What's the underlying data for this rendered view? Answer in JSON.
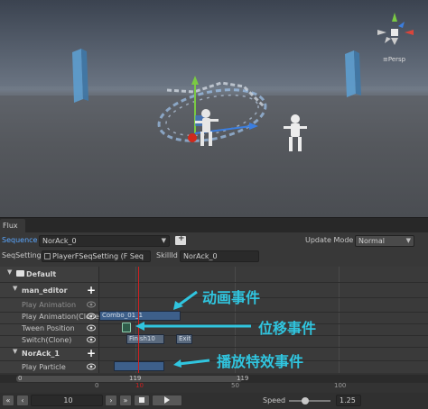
{
  "scene": {
    "gizmo_label": "≡Persp"
  },
  "panel": {
    "tab_label": "Flux"
  },
  "sequence": {
    "label": "Sequence",
    "value": "NorAck_0",
    "add_icon": "folder-plus-icon",
    "update_mode_label": "Update Mode",
    "update_mode_value": "Normal"
  },
  "seq_setting": {
    "label": "SeqSetting",
    "value": "PlayerFSeqSetting (F Seq",
    "skill_id_label": "SkillId",
    "skill_id_value": "NorAck_0"
  },
  "tracks": {
    "default_label": "Default",
    "groups": [
      {
        "name": "man_editor",
        "items": [
          "Play Animation",
          "Play Animation(Clone",
          "Tween Position",
          "Switch(Clone)"
        ]
      },
      {
        "name": "NorAck_1",
        "items": [
          "Play Particle"
        ]
      }
    ]
  },
  "events": {
    "combo": "Combo_01_1",
    "finish": "Finish10",
    "exit": "Exit"
  },
  "annotations": {
    "anim": "动画事件",
    "move": "位移事件",
    "fx": "播放特效事件"
  },
  "ruler": {
    "start": "0",
    "mid": "119",
    "ticks": [
      "0",
      "10",
      "50",
      "100"
    ],
    "marker": "119"
  },
  "playback": {
    "frame": "10",
    "speed_label": "Speed",
    "speed_value": "1.25",
    "speed_fraction": 0.4
  },
  "colors": {
    "event_blue": "#3d5f8a",
    "event_green": "#2f5c4a",
    "event_gray": "#5a6a7e",
    "cursor_red": "#d02020",
    "annotation_cyan": "#30c5df"
  }
}
